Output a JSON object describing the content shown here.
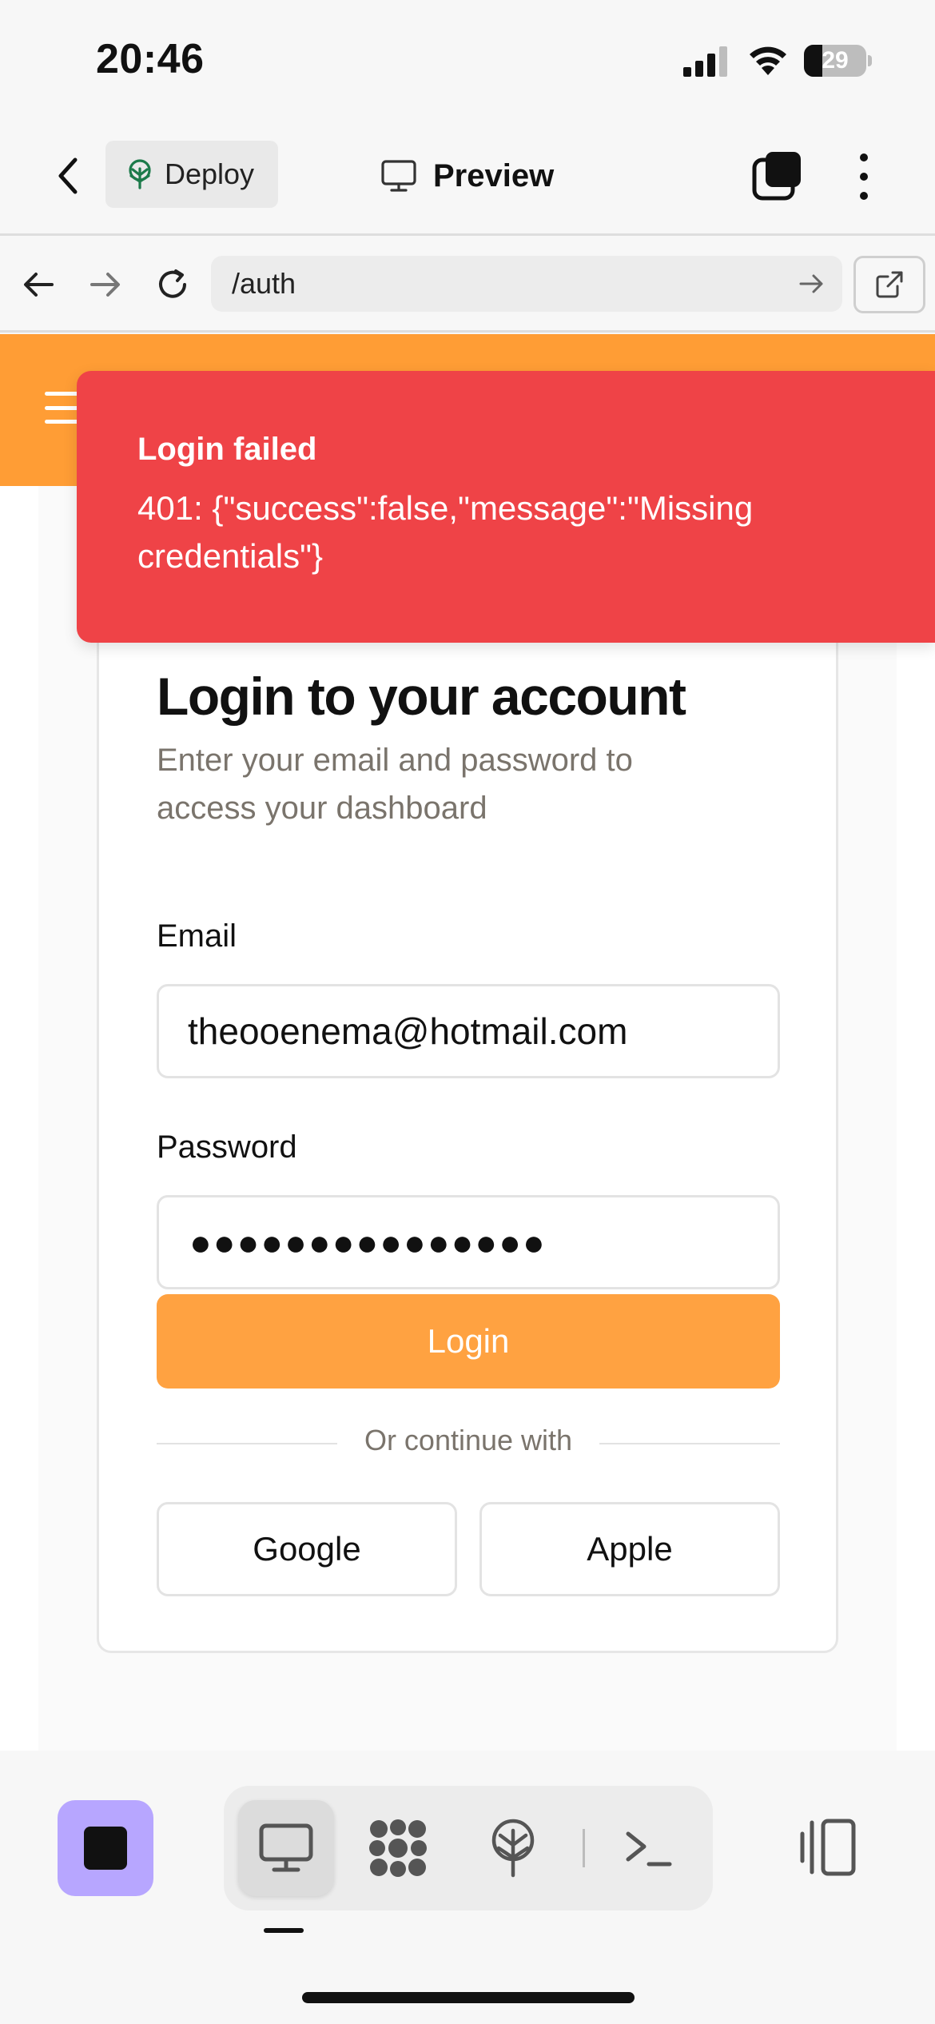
{
  "status_bar": {
    "time": "20:46",
    "battery_level": "29",
    "battery_fraction": 0.29
  },
  "app_header": {
    "deploy_label": "Deploy",
    "preview_label": "Preview",
    "icons": {
      "back": "chevron-left-icon",
      "deploy": "tree-icon",
      "preview": "monitor-icon",
      "tabs": "tabs-icon",
      "more": "more-vertical-icon"
    }
  },
  "url_bar": {
    "value": "/auth",
    "icons": [
      "back-arrow-icon",
      "forward-arrow-icon",
      "reload-icon",
      "go-arrow-icon",
      "external-link-icon"
    ]
  },
  "site": {
    "nav_color": "#ff9d35",
    "toast": {
      "title": "Login failed",
      "message": "401: {\"success\":false,\"message\":\"Missing credentials\"}",
      "color": "#ef4347"
    },
    "login": {
      "title": "Login to your account",
      "subtitle": "Enter your email and password to access your dashboard",
      "email_label": "Email",
      "email_value": "theooenema@hotmail.com",
      "password_label": "Password",
      "password_mask": "●●●●●●●●●●●●●●●",
      "login_button": "Login",
      "divider_text": "Or continue with",
      "google_button": "Google",
      "apple_button": "Apple",
      "button_color": "#ffa241"
    }
  },
  "bottom_bar": {
    "stop_color": "#b7a6ff",
    "segments": [
      "monitor-icon",
      "apps-icon",
      "deploy-icon",
      "terminal-icon"
    ],
    "active_segment": "monitor-icon"
  }
}
